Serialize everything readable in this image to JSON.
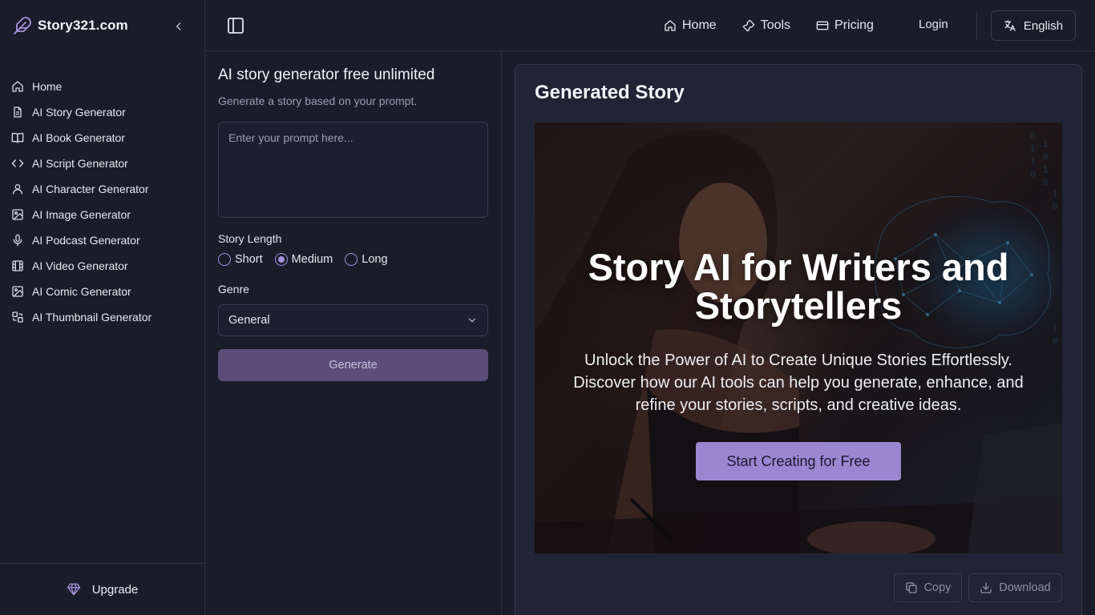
{
  "brand": {
    "name": "Story321.com",
    "logo_icon": "feather-icon"
  },
  "sidebar": {
    "items": [
      {
        "label": "Home",
        "icon": "home-icon"
      },
      {
        "label": "AI Story Generator",
        "icon": "document-icon"
      },
      {
        "label": "AI Book Generator",
        "icon": "book-icon"
      },
      {
        "label": "AI Script Generator",
        "icon": "code-icon"
      },
      {
        "label": "AI Character Generator",
        "icon": "user-icon"
      },
      {
        "label": "AI Image Generator",
        "icon": "image-icon"
      },
      {
        "label": "AI Podcast Generator",
        "icon": "microphone-icon"
      },
      {
        "label": "AI Video Generator",
        "icon": "film-icon"
      },
      {
        "label": "AI Comic Generator",
        "icon": "image-icon"
      },
      {
        "label": "AI Thumbnail Generator",
        "icon": "thumbnail-icon"
      }
    ],
    "upgrade_label": "Upgrade"
  },
  "topnav": {
    "home": "Home",
    "tools": "Tools",
    "pricing": "Pricing",
    "login": "Login",
    "language": "English"
  },
  "form": {
    "title": "AI story generator free unlimited",
    "subtitle": "Generate a story based on your prompt.",
    "prompt_placeholder": "Enter your prompt here...",
    "story_length_label": "Story Length",
    "length_options": [
      "Short",
      "Medium",
      "Long"
    ],
    "length_selected": "Medium",
    "genre_label": "Genre",
    "genre_value": "General",
    "generate_label": "Generate"
  },
  "result": {
    "title": "Generated Story",
    "hero": {
      "heading": "Story AI for Writers and Storytellers",
      "text": "Unlock the Power of AI to Create Unique Stories Effortlessly. Discover how our AI tools can help you generate, enhance, and refine your stories, scripts, and creative ideas.",
      "cta": "Start Creating for Free"
    },
    "copy_label": "Copy",
    "download_label": "Download"
  },
  "colors": {
    "background": "#1a1c2a",
    "card": "#212435",
    "accent": "#9a87d1",
    "generate_button": "#5a4d79"
  }
}
